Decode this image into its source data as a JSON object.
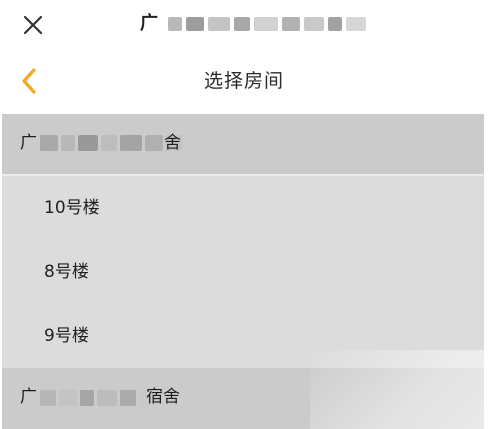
{
  "topbar": {
    "title_visible_char": "广",
    "close_icon": "close-icon"
  },
  "navbar": {
    "title": "选择房间",
    "back_icon": "chevron-left-icon",
    "accent_color": "#f5a623"
  },
  "groups": [
    {
      "label_start": "广",
      "label_end": "舍",
      "items": [
        "10号楼",
        "8号楼",
        "9号楼"
      ]
    },
    {
      "label_start": "广",
      "label_end": "宿舍",
      "items": []
    }
  ],
  "colors": {
    "list_background": "#dcdcdc",
    "group_header_background": "#cbcbcb"
  }
}
